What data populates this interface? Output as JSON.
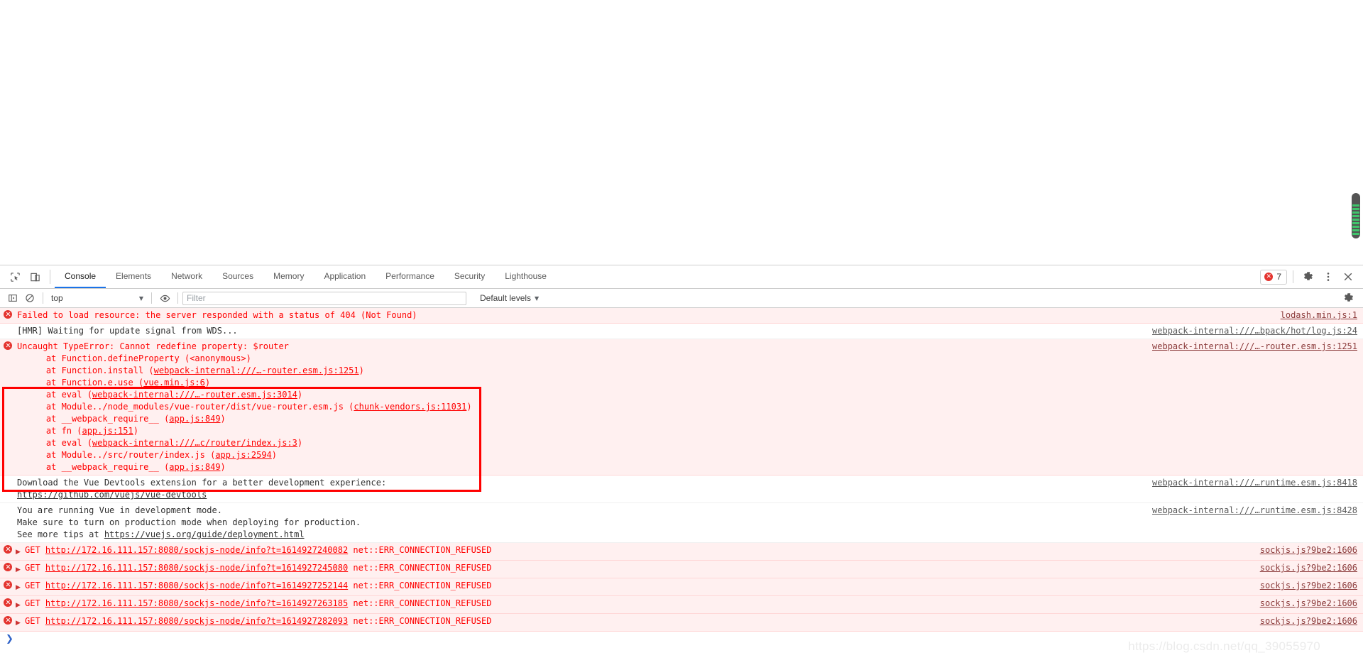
{
  "window": {
    "page_background": "#ffffff",
    "scrollbar": {
      "thumb_color": "#545454",
      "stripe_color": "#3fc46b"
    }
  },
  "tabbar": {
    "icons": [
      {
        "name": "inspect-element-icon",
        "title": "Inspect"
      },
      {
        "name": "device-toolbar-icon",
        "title": "Toggle device toolbar"
      }
    ],
    "tabs": [
      {
        "label": "Console",
        "active": true
      },
      {
        "label": "Elements",
        "active": false
      },
      {
        "label": "Network",
        "active": false
      },
      {
        "label": "Sources",
        "active": false
      },
      {
        "label": "Memory",
        "active": false
      },
      {
        "label": "Application",
        "active": false
      },
      {
        "label": "Performance",
        "active": false
      },
      {
        "label": "Security",
        "active": false
      },
      {
        "label": "Lighthouse",
        "active": false
      }
    ],
    "error_count": "7",
    "error_accent": "#e4342f",
    "active_tab_accent": "#1a73e8",
    "right_icons": [
      {
        "name": "settings-gear-icon"
      },
      {
        "name": "more-options-icon"
      },
      {
        "name": "close-devtools-icon"
      }
    ]
  },
  "filterbar": {
    "sidebar_toggle": "console-sidebar-icon",
    "clear_console": "clear-console-icon",
    "context": "top",
    "context_caret": "▼",
    "eye_icon": "live-expression-eye-icon",
    "filter_placeholder": "Filter",
    "filter_value": "",
    "levels_label": "Default levels",
    "levels_caret": "▼",
    "settings_icon": "console-settings-gear-icon"
  },
  "console": {
    "messages": [
      {
        "type": "error",
        "text": "Failed to load resource: the server responded with a status of 404 (Not Found)",
        "source": "lodash.min.js:1"
      },
      {
        "type": "info",
        "text": "[HMR] Waiting for update signal from WDS...",
        "source": "webpack-internal:///…bpack/hot/log.js:24"
      },
      {
        "type": "error",
        "text": "Uncaught TypeError: Cannot redefine property: $router",
        "source": "webpack-internal:///…-router.esm.js:1251",
        "stack": [
          {
            "pre": "    at Function.defineProperty (<anonymous>)"
          },
          {
            "pre": "    at Function.install (",
            "link": "webpack-internal:///…-router.esm.js:1251",
            "post": ")"
          },
          {
            "pre": "    at Function.e.use (",
            "link": "vue.min.js:6",
            "post": ")"
          },
          {
            "pre": "    at eval (",
            "link": "webpack-internal:///…-router.esm.js:3014",
            "post": ")"
          },
          {
            "pre": "    at Module../node_modules/vue-router/dist/vue-router.esm.js (",
            "link": "chunk-vendors.js:11031",
            "post": ")"
          },
          {
            "pre": "    at __webpack_require__ (",
            "link": "app.js:849",
            "post": ")"
          },
          {
            "pre": "    at fn (",
            "link": "app.js:151",
            "post": ")"
          },
          {
            "pre": "    at eval (",
            "link": "webpack-internal:///…c/router/index.js:3",
            "post": ")"
          },
          {
            "pre": "    at Module../src/router/index.js (",
            "link": "app.js:2594",
            "post": ")"
          },
          {
            "pre": "    at __webpack_require__ (",
            "link": "app.js:849",
            "post": ")"
          }
        ]
      },
      {
        "type": "info",
        "text": "Download the Vue Devtools extension for a better development experience:",
        "link": "https://github.com/vuejs/vue-devtools",
        "source": "webpack-internal:///…runtime.esm.js:8418"
      },
      {
        "type": "info",
        "text": "You are running Vue in development mode.\nMake sure to turn on production mode when deploying for production.\nSee more tips at ",
        "link": "https://vuejs.org/guide/deployment.html",
        "source": "webpack-internal:///…runtime.esm.js:8428"
      },
      {
        "type": "error",
        "method": "GET",
        "url": "http://172.16.111.157:8080/sockjs-node/info?t=1614927240082",
        "suffix": " net::ERR_CONNECTION_REFUSED",
        "source": "sockjs.js?9be2:1606"
      },
      {
        "type": "error",
        "method": "GET",
        "url": "http://172.16.111.157:8080/sockjs-node/info?t=1614927245080",
        "suffix": " net::ERR_CONNECTION_REFUSED",
        "source": "sockjs.js?9be2:1606"
      },
      {
        "type": "error",
        "method": "GET",
        "url": "http://172.16.111.157:8080/sockjs-node/info?t=1614927252144",
        "suffix": " net::ERR_CONNECTION_REFUSED",
        "source": "sockjs.js?9be2:1606"
      },
      {
        "type": "error",
        "method": "GET",
        "url": "http://172.16.111.157:8080/sockjs-node/info?t=1614927263185",
        "suffix": " net::ERR_CONNECTION_REFUSED",
        "source": "sockjs.js?9be2:1606"
      },
      {
        "type": "error",
        "method": "GET",
        "url": "http://172.16.111.157:8080/sockjs-node/info?t=1614927282093",
        "suffix": " net::ERR_CONNECTION_REFUSED",
        "source": "sockjs.js?9be2:1606"
      }
    ],
    "prompt_symbol": "❯"
  },
  "annotation": {
    "color": "#ff0000",
    "label": "highlight-rectangle"
  },
  "watermark": {
    "text": "https://blog.csdn.net/qq_39055970"
  }
}
